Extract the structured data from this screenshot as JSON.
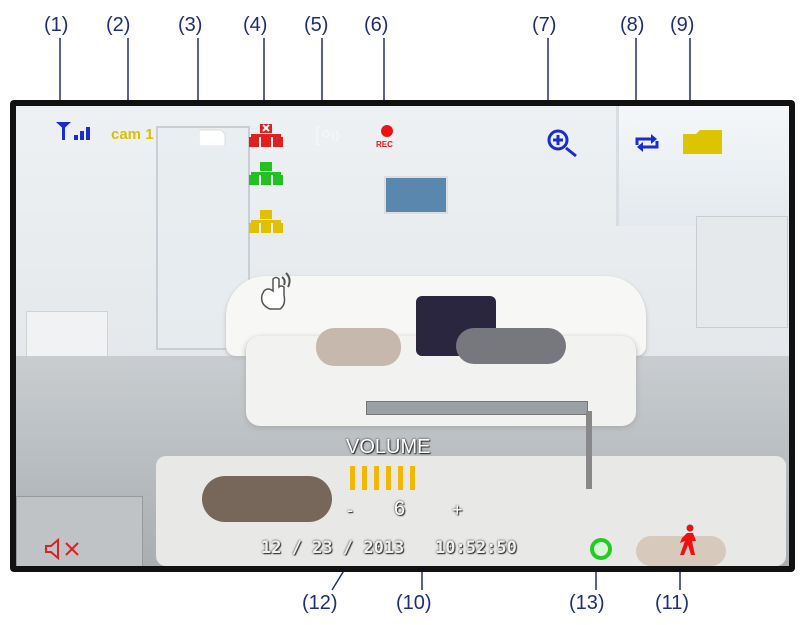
{
  "callouts": {
    "c1": "(1)",
    "c2": "(2)",
    "c3": "(3)",
    "c4": "(4)",
    "c5": "(5)",
    "c6": "(6)",
    "c7": "(7)",
    "c8": "(8)",
    "c9": "(9)",
    "c10": "(10)",
    "c11": "(11)",
    "c12": "(12)",
    "c13": "(13)"
  },
  "osd": {
    "camera_label": "cam 1",
    "rec_label": "REC",
    "volume": {
      "title": "VOLUME",
      "minus": "-",
      "value": "6",
      "plus": "+",
      "level_bars": 6
    },
    "datetime": "12 / 23 / 2013   10:52:50"
  },
  "icons": {
    "signal": "signal-strength-icon",
    "sd_card": "sd-card-icon",
    "network_error": "network-disconnected-icon",
    "network_ok": "network-connected-icon",
    "network_standby": "network-standby-icon",
    "voice": "talk-icon",
    "record": "record-icon",
    "zoom": "zoom-in-icon",
    "cycle": "auto-cycle-icon",
    "folder": "folder-icon",
    "mute": "speaker-mute-icon",
    "talk_hand": "push-to-talk-icon",
    "motion": "motion-detect-icon",
    "status_dot": "status-indicator-icon"
  },
  "colors": {
    "accent_blue": "#1a2cd0",
    "cam_label": "#d8c000",
    "network_red": "#e02020",
    "network_green": "#22c020",
    "network_yellow": "#e0c000",
    "rec_red": "#ee1111",
    "folder_yellow": "#ddc400",
    "volume_bar": "#f2b800",
    "status_green": "#22cc22"
  }
}
